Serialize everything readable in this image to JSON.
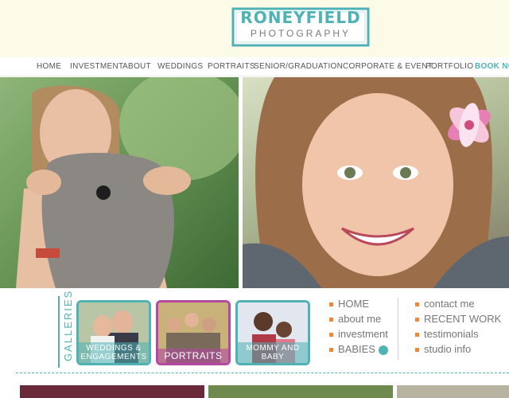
{
  "logo": {
    "main": "RONEYFIELD",
    "sub": "PHOTOGRAPHY"
  },
  "nav": {
    "items": [
      "HOME",
      "INVESTMENT",
      "ABOUT",
      "WEDDINGS",
      "PORTRAITS",
      "SENIOR/GRADUATION",
      "CORPORATE & EVENT",
      "PORTFOLIO",
      "BOOK NO"
    ]
  },
  "galleries": {
    "label": "GALLERIES",
    "tiles": [
      {
        "caption": "WEDDINGS & ENGAGEMENTS"
      },
      {
        "caption": "PORTRAITS"
      },
      {
        "caption": "MOMMY AND BABY"
      }
    ]
  },
  "menu_left": [
    "HOME",
    "about me",
    "investment",
    "BABIES"
  ],
  "menu_right": [
    "contact me",
    "RECENT WORK",
    "testimonials",
    "studio info"
  ],
  "colors": {
    "accent": "#4fb3b5",
    "header_bg": "#fbfbe8",
    "bullet": "#e88a3a",
    "portraits_accent": "#b34aa0"
  }
}
